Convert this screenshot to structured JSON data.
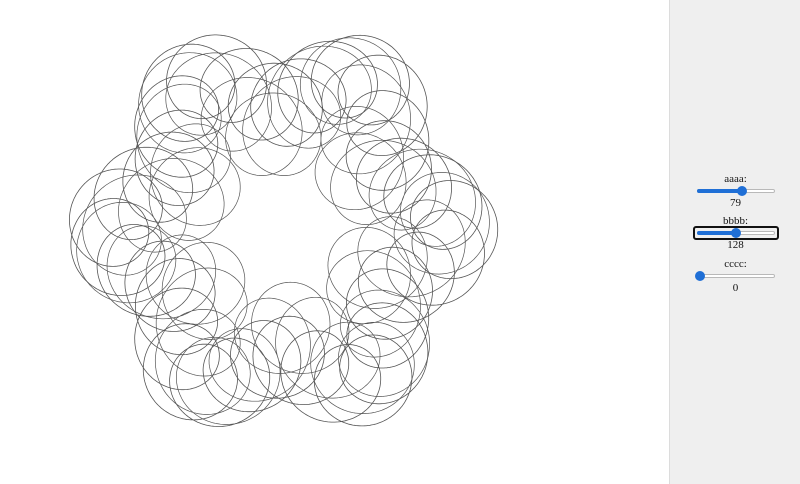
{
  "canvas": {
    "stroke_color": "#555555"
  },
  "controls": [
    {
      "label": "aaaa:",
      "value": "79",
      "fraction": 0.59,
      "focused": false
    },
    {
      "label": "bbbb:",
      "value": "128",
      "fraction": 0.51,
      "focused": true
    },
    {
      "label": "cccc:",
      "value": "0",
      "fraction": 0.0,
      "focused": false
    }
  ],
  "colors": {
    "panel_background": "#efefef",
    "slider_accent": "#1f6fd6"
  }
}
